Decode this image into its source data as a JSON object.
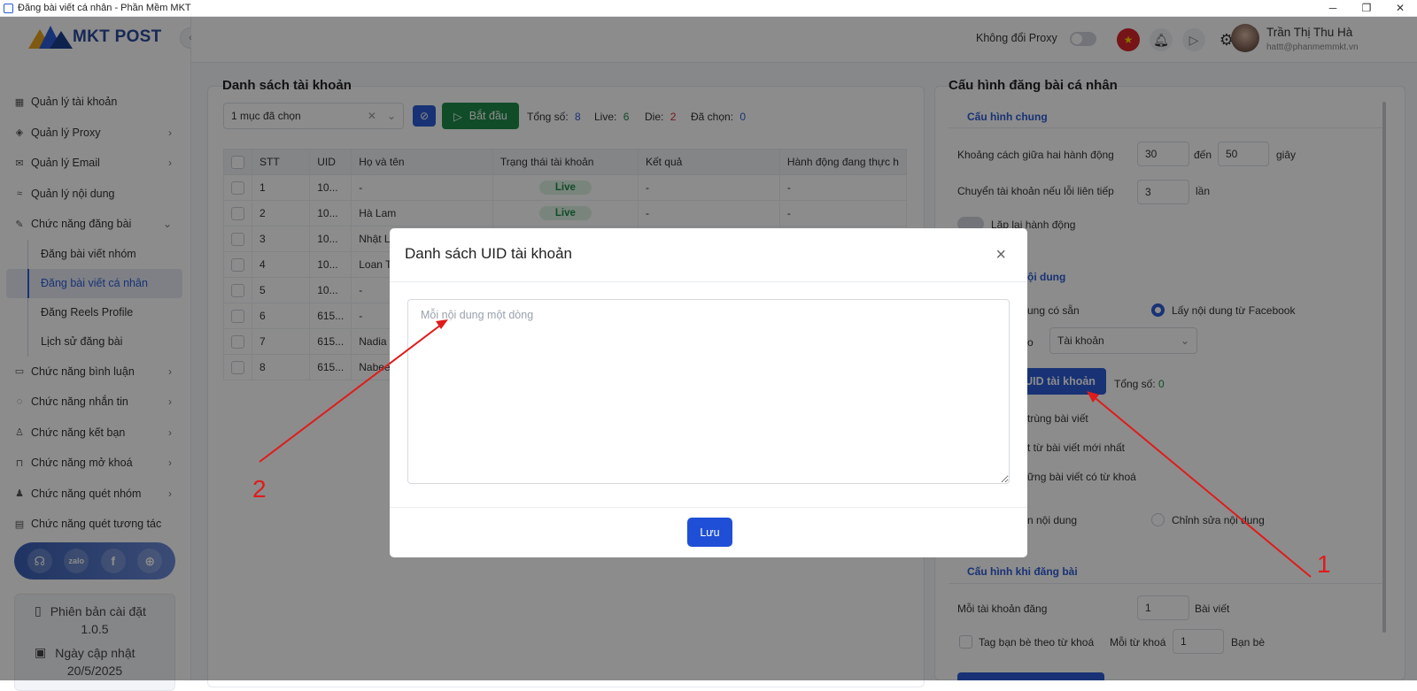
{
  "window": {
    "title": "Đăng bài viết cá nhân - Phần Mềm MKT",
    "minimize": "─",
    "restore": "❐",
    "close": "✕"
  },
  "brand": {
    "name": "MKT POST"
  },
  "sidebar": {
    "items": [
      {
        "label": "Quản lý tài khoản",
        "icon": "dashboard-icon"
      },
      {
        "label": "Quản lý Proxy",
        "icon": "layers-icon"
      },
      {
        "label": "Quản lý Email",
        "icon": "mail-icon"
      },
      {
        "label": "Quản lý nội dung",
        "icon": "content-icon"
      },
      {
        "label": "Chức năng đăng bài",
        "icon": "edit-icon"
      },
      {
        "label": "Chức năng bình luận",
        "icon": "comment-icon"
      },
      {
        "label": "Chức năng nhắn tin",
        "icon": "chat-icon"
      },
      {
        "label": "Chức năng kết bạn",
        "icon": "add-friend-icon"
      },
      {
        "label": "Chức năng mở khoá",
        "icon": "unlock-icon"
      },
      {
        "label": "Chức năng quét nhóm",
        "icon": "group-icon"
      },
      {
        "label": "Chức năng quét tương tác",
        "icon": "list-icon"
      }
    ],
    "subitems": [
      "Đăng bài viết nhóm",
      "Đăng bài viết cá nhân",
      "Đăng Reels Profile",
      "Lịch sử đăng bài"
    ],
    "version_label": "Phiên bản cài đặt",
    "version": "1.0.5",
    "update_label": "Ngày cập nhật",
    "update_date": "20/5/2025"
  },
  "topbar": {
    "proxy_label": "Không đổi Proxy",
    "user_name": "Trần Thị Thu Hà",
    "user_email": "hattt@phanmemmkt.vn"
  },
  "accounts": {
    "title": "Danh sách tài khoản",
    "select_value": "1 mục đã chọn",
    "start_label": "Bắt đầu",
    "total_label": "Tổng số:",
    "total": "8",
    "live_label": "Live:",
    "live": "6",
    "die_label": "Die:",
    "die": "2",
    "selected_label": "Đã chọn:",
    "selected": "0",
    "columns": [
      "STT",
      "UID",
      "Họ và tên",
      "Trạng thái tài khoản",
      "Kết quả",
      "Hành động đang thực h"
    ],
    "rows": [
      {
        "stt": "1",
        "uid": "10...",
        "name": "-",
        "status": "Live",
        "result": "-",
        "action": "-"
      },
      {
        "stt": "2",
        "uid": "10...",
        "name": "Hà Lam",
        "status": "Live",
        "result": "-",
        "action": "-"
      },
      {
        "stt": "3",
        "uid": "10...",
        "name": "Nhật Lan",
        "status": "",
        "result": "",
        "action": ""
      },
      {
        "stt": "4",
        "uid": "10...",
        "name": "Loan Tra",
        "status": "",
        "result": "",
        "action": ""
      },
      {
        "stt": "5",
        "uid": "10...",
        "name": "-",
        "status": "",
        "result": "",
        "action": ""
      },
      {
        "stt": "6",
        "uid": "615...",
        "name": "-",
        "status": "",
        "result": "",
        "action": ""
      },
      {
        "stt": "7",
        "uid": "615...",
        "name": "Nadia W",
        "status": "",
        "result": "",
        "action": ""
      },
      {
        "stt": "8",
        "uid": "615...",
        "name": "Nabeela",
        "status": "",
        "result": "",
        "action": ""
      }
    ]
  },
  "config": {
    "title": "Cấu hình đăng bài cá nhân",
    "general": "Cấu hình chung",
    "interval_label": "Khoảng cách giữa hai hành động",
    "interval_from": "30",
    "to_label": "đến",
    "interval_to": "50",
    "seconds": "giây",
    "switch_label": "Chuyển tài khoản nếu lỗi liên tiếp",
    "switch_value": "3",
    "times": "lần",
    "repeat_label": "Lặp lại hành động",
    "content_section": "ội dung",
    "opt_available": "ung có sẵn",
    "opt_facebook": "Lấy nội dung từ Facebook",
    "by_label": "o",
    "by_value": "Tài khoản",
    "uid_button": "UID tài khoản",
    "uid_total_label": "Tổng số:",
    "uid_total": "0",
    "dup_label": "trùng bài viết",
    "newest_label": "t từ bài viết mới nhất",
    "keyword_label": "ững bài viết có từ khoá",
    "keep_label": "n nội dung",
    "edit_label": "Chỉnh sửa nội dung",
    "posting": "Cấu hình khi đăng bài",
    "per_account_label": "Mỗi tài khoản đăng",
    "per_account": "1",
    "posts": "Bài viết",
    "tag_label": "Tag bạn bè theo từ khoá",
    "per_keyword_label": "Mỗi từ khoá",
    "per_keyword": "1",
    "friends": "Bạn bè"
  },
  "modal": {
    "title": "Danh sách UID tài khoản",
    "placeholder": "Mỗi nội dung một dòng",
    "save": "Lưu",
    "close": "×"
  },
  "annotations": {
    "one": "1",
    "two": "2",
    "color": "#e01b1b"
  }
}
